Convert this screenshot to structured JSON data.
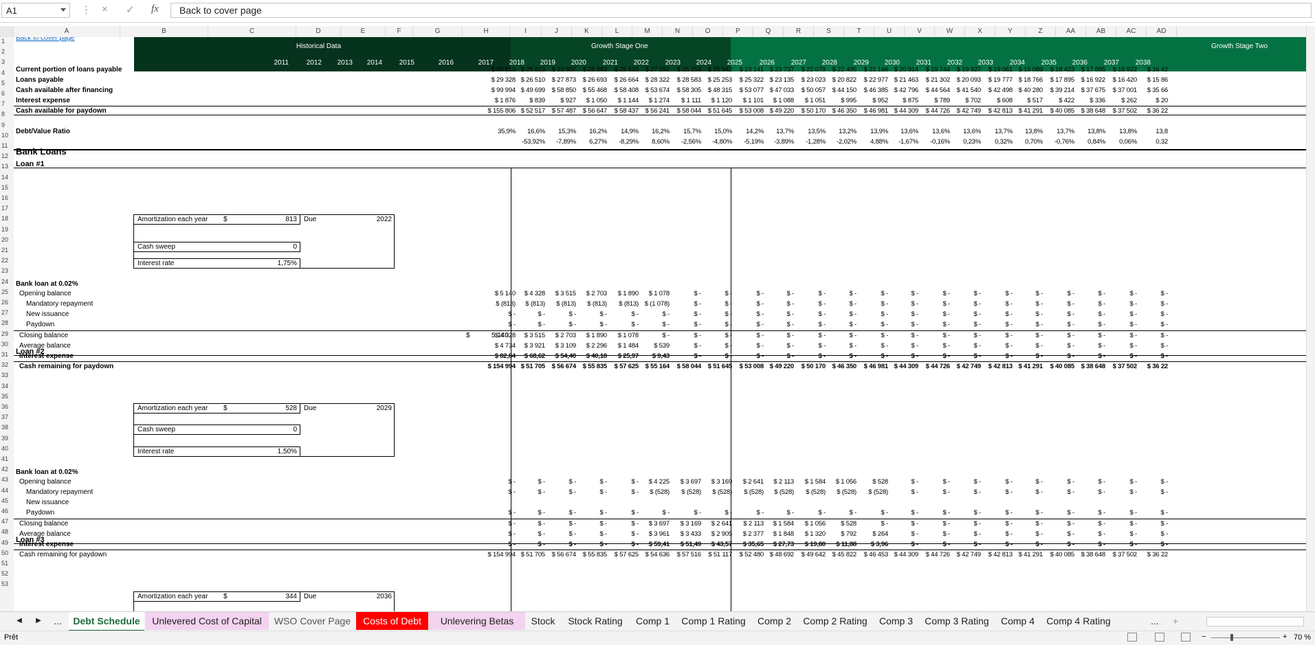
{
  "formula_bar": {
    "cell_ref": "A1",
    "content": "Back to cover page",
    "cancel_icon": "×",
    "enter_icon": "✓",
    "fx_icon": "fx"
  },
  "columns": [
    "A",
    "B",
    "C",
    "D",
    "E",
    "F",
    "G",
    "H",
    "I",
    "J",
    "K",
    "L",
    "M",
    "N",
    "O",
    "P",
    "Q",
    "R",
    "S",
    "T",
    "U",
    "V",
    "W",
    "X",
    "Y",
    "Z",
    "AA",
    "AB",
    "AC",
    "AD"
  ],
  "rows": [
    "1",
    "2",
    "3",
    "4",
    "5",
    "6",
    "7",
    "8",
    "9",
    "10",
    "11",
    "12",
    "13",
    "14",
    "15",
    "16",
    "17",
    "18",
    "19",
    "20",
    "21",
    "22",
    "23",
    "24",
    "25",
    "26",
    "27",
    "28",
    "29",
    "30",
    "31",
    "32",
    "33",
    "34",
    "35",
    "36",
    "37",
    "38",
    "39",
    "40",
    "41",
    "42",
    "43",
    "44",
    "45",
    "46",
    "47",
    "48",
    "49",
    "50",
    "51",
    "52",
    "53"
  ],
  "header": {
    "back_link": "Back to cover page",
    "historical": "Historical Data",
    "stage_one": "Growth Stage One",
    "stage_two": "Growth Stage Two",
    "years": [
      "2011",
      "2012",
      "2013",
      "2014",
      "2015",
      "2016",
      "2017",
      "2018",
      "2019",
      "2020",
      "2021",
      "2022",
      "2023",
      "2024",
      "2025",
      "2026",
      "2027",
      "2028",
      "2029",
      "2030",
      "2031",
      "2032",
      "2033",
      "2034",
      "2035",
      "2036",
      "2037",
      "2038"
    ],
    "band_colors": {
      "historical": "#05331e",
      "stage_one": "#054425",
      "stage_two": "#047143"
    }
  },
  "summary": {
    "labels": {
      "r5": "Current portion of loans payable",
      "r6": "Loans payable",
      "r7": "Cash available after financing",
      "r8": "Interest expense",
      "r10": "Cash available for paydown",
      "r12": "Debt/Value Ratio"
    },
    "r5": [
      "$ 80 813",
      "$ 25 813",
      "$ 23 807",
      "$ 25 983",
      "$ 25 615",
      "$ 27 192",
      "$ 25 153",
      "$ 25 942",
      "$ 23 141",
      "$ 23 737",
      "$ 22 079",
      "$ 22 495",
      "$ 21 166",
      "$ 20 914",
      "$ 19 744",
      "$ 19 927",
      "$ 19 061",
      "$ 19 089",
      "$ 18 423",
      "$ 17 895",
      "$ 16 922",
      "$ 16 42"
    ],
    "r6": [
      "$ 29 328",
      "$ 26 510",
      "$ 27 873",
      "$ 26 693",
      "$ 26 664",
      "$ 28 322",
      "$ 28 583",
      "$ 25 253",
      "$ 25 322",
      "$ 23 135",
      "$ 23 023",
      "$ 20 822",
      "$ 22 977",
      "$ 21 463",
      "$ 21 302",
      "$ 20 093",
      "$ 19 777",
      "$ 18 766",
      "$ 17 895",
      "$ 16 922",
      "$ 16 420",
      "$ 15 86"
    ],
    "r7": [
      "$ 99 994",
      "$ 49 699",
      "$ 58 850",
      "$ 55 468",
      "$ 58 408",
      "$ 53 674",
      "$ 58 305",
      "$ 48 315",
      "$ 53 077",
      "$ 47 033",
      "$ 50 057",
      "$ 44 150",
      "$ 46 385",
      "$ 42 796",
      "$ 44 564",
      "$ 41 540",
      "$ 42 498",
      "$ 40 280",
      "$ 39 214",
      "$ 37 675",
      "$ 37 001",
      "$ 35 66"
    ],
    "r8": [
      "$ 1 876",
      "$ 839",
      "$ 927",
      "$ 1 050",
      "$ 1 144",
      "$ 1 274",
      "$ 1 111",
      "$ 1 120",
      "$ 1 101",
      "$ 1 088",
      "$ 1 051",
      "$ 995",
      "$ 952",
      "$ 875",
      "$ 789",
      "$ 702",
      "$ 608",
      "$ 517",
      "$ 422",
      "$ 336",
      "$ 262",
      "$ 20"
    ],
    "r10": [
      "$ 155 806",
      "$ 52 517",
      "$ 57 487",
      "$ 56 647",
      "$ 58 437",
      "$ 56 241",
      "$ 58 044",
      "$ 51 645",
      "$ 53 008",
      "$ 49 220",
      "$ 50 170",
      "$ 46 350",
      "$ 46 981",
      "$ 44 309",
      "$ 44 726",
      "$ 42 749",
      "$ 42 813",
      "$ 41 291",
      "$ 40 085",
      "$ 38 648",
      "$ 37 502",
      "$ 36 22"
    ],
    "r12": [
      "35,9%",
      "16,6%",
      "15,3%",
      "16,2%",
      "14,9%",
      "16,2%",
      "15,7%",
      "15,0%",
      "14,2%",
      "13,7%",
      "13,5%",
      "13,2%",
      "13,9%",
      "13,6%",
      "13,6%",
      "13,6%",
      "13,7%",
      "13,8%",
      "13,7%",
      "13,8%",
      "13,8%",
      "13,8"
    ],
    "r13": [
      "",
      "-53,92%",
      "-7,89%",
      "6,27%",
      "-8,29%",
      "8,60%",
      "-2,56%",
      "-4,80%",
      "-5,19%",
      "-3,89%",
      "-1,28%",
      "-2,02%",
      "4,88%",
      "-1,67%",
      "-0,16%",
      "0,23%",
      "0,32%",
      "0,70%",
      "-0,76%",
      "0,84%",
      "0,06%",
      "0,32"
    ]
  },
  "bank_loans_title": "Bank Loans",
  "loan1": {
    "title": "Loan #1",
    "amort_label": "Amortization each year",
    "amort_cur": "$",
    "amort_value": "813",
    "due_label": "Due",
    "due_value": "2022",
    "sweep_label": "Cash sweep",
    "sweep_value": "0",
    "rate_label": "Interest rate",
    "rate_value": "1,75%",
    "section_label": "Bank loan at 0.02%",
    "row_labels": [
      "Opening balance",
      "Mandatory repayment",
      "New issuance",
      "Paydown",
      "Closing balance",
      "Average balance",
      "Interest expense",
      "Cash remaining for paydown"
    ],
    "h27_cur": "$",
    "h27_value": "5 140",
    "r23": [
      "$ 5 140",
      "$ 4 328",
      "$ 3 515",
      "$ 2 703",
      "$ 1 890",
      "$ 1 078",
      "$ -",
      "$ -",
      "$ -",
      "$ -",
      "$ -",
      "$ -",
      "$ -",
      "$ -",
      "$ -",
      "$ -",
      "$ -",
      "$ -",
      "$ -",
      "$ -",
      "$ -",
      "$ -"
    ],
    "r24": [
      "$ (813)",
      "$ (813)",
      "$ (813)",
      "$ (813)",
      "$ (813)",
      "$ (1 078)",
      "$ -",
      "$ -",
      "$ -",
      "$ -",
      "$ -",
      "$ -",
      "$ -",
      "$ -",
      "$ -",
      "$ -",
      "$ -",
      "$ -",
      "$ -",
      "$ -",
      "$ -",
      "$ -"
    ],
    "r25": [
      "$ -",
      "$ -",
      "$ -",
      "$ -",
      "$ -",
      "$ -",
      "$ -",
      "$ -",
      "$ -",
      "$ -",
      "$ -",
      "$ -",
      "$ -",
      "$ -",
      "$ -",
      "$ -",
      "$ -",
      "$ -",
      "$ -",
      "$ -",
      "$ -",
      "$ -"
    ],
    "r26": [
      "$ -",
      "$ -",
      "$ -",
      "$ -",
      "$ -",
      "$ -",
      "$ -",
      "$ -",
      "$ -",
      "$ -",
      "$ -",
      "$ -",
      "$ -",
      "$ -",
      "$ -",
      "$ -",
      "$ -",
      "$ -",
      "$ -",
      "$ -",
      "$ -",
      "$ -"
    ],
    "r27": [
      "$ 4 328",
      "$ 3 515",
      "$ 2 703",
      "$ 1 890",
      "$ 1 078",
      "$ -",
      "$ -",
      "$ -",
      "$ -",
      "$ -",
      "$ -",
      "$ -",
      "$ -",
      "$ -",
      "$ -",
      "$ -",
      "$ -",
      "$ -",
      "$ -",
      "$ -",
      "$ -",
      "$ -"
    ],
    "r28": [
      "$ 4 734",
      "$ 3 921",
      "$ 3 109",
      "$ 2 296",
      "$ 1 484",
      "$ 539",
      "$ -",
      "$ -",
      "$ -",
      "$ -",
      "$ -",
      "$ -",
      "$ -",
      "$ -",
      "$ -",
      "$ -",
      "$ -",
      "$ -",
      "$ -",
      "$ -",
      "$ -",
      "$ -"
    ],
    "r29": [
      "$ 82,84",
      "$ 68,62",
      "$ 54,40",
      "$ 40,18",
      "$ 25,97",
      "$ 9,43",
      "$ -",
      "$ -",
      "$ -",
      "$ -",
      "$ -",
      "$ -",
      "$ -",
      "$ -",
      "$ -",
      "$ -",
      "$ -",
      "$ -",
      "$ -",
      "$ -",
      "$ -",
      "$ -"
    ],
    "r30": [
      "$ 154 994",
      "$ 51 705",
      "$ 56 674",
      "$ 55 835",
      "$ 57 625",
      "$ 55 164",
      "$ 58 044",
      "$ 51 645",
      "$ 53 008",
      "$ 49 220",
      "$ 50 170",
      "$ 46 350",
      "$ 46 981",
      "$ 44 309",
      "$ 44 726",
      "$ 42 749",
      "$ 42 813",
      "$ 41 291",
      "$ 40 085",
      "$ 38 648",
      "$ 37 502",
      "$ 36 22"
    ]
  },
  "loan2": {
    "title": "Loan #2",
    "amort_label": "Amortization each year",
    "amort_cur": "$",
    "amort_value": "528",
    "due_label": "Due",
    "due_value": "2029",
    "sweep_label": "Cash sweep",
    "sweep_value": "0",
    "rate_label": "Interest rate",
    "rate_value": "1,50%",
    "section_label": "Bank loan at 0.02%",
    "row_labels": [
      "Opening balance",
      "Mandatory repayment",
      "New issuance",
      "Paydown",
      "Closing balance",
      "Average balance",
      "Interest expense",
      "Cash remaining for paydown"
    ],
    "r41": [
      "$ -",
      "$ -",
      "$ -",
      "$ -",
      "$ -",
      "$ 4 225",
      "$ 3 697",
      "$ 3 169",
      "$ 2 641",
      "$ 2 113",
      "$ 1 584",
      "$ 1 056",
      "$ 528",
      "$ -",
      "$ -",
      "$ -",
      "$ -",
      "$ -",
      "$ -",
      "$ -",
      "$ -",
      "$ -"
    ],
    "r42": [
      "$ -",
      "$ -",
      "$ -",
      "$ -",
      "$ -",
      "$ (528)",
      "$ (528)",
      "$ (528)",
      "$ (528)",
      "$ (528)",
      "$ (528)",
      "$ (528)",
      "$ (528)",
      "$ -",
      "$ -",
      "$ -",
      "$ -",
      "$ -",
      "$ -",
      "$ -",
      "$ -",
      "$ -"
    ],
    "r44": [
      "$ -",
      "$ -",
      "$ -",
      "$ -",
      "$ -",
      "$ -",
      "$ -",
      "$ -",
      "$ -",
      "$ -",
      "$ -",
      "$ -",
      "$ -",
      "$ -",
      "$ -",
      "$ -",
      "$ -",
      "$ -",
      "$ -",
      "$ -",
      "$ -",
      "$ -"
    ],
    "r45": [
      "$ -",
      "$ -",
      "$ -",
      "$ -",
      "$ -",
      "$ 3 697",
      "$ 3 169",
      "$ 2 641",
      "$ 2 113",
      "$ 1 584",
      "$ 1 056",
      "$ 528",
      "$ -",
      "$ -",
      "$ -",
      "$ -",
      "$ -",
      "$ -",
      "$ -",
      "$ -",
      "$ -",
      "$ -"
    ],
    "r46": [
      "$ -",
      "$ -",
      "$ -",
      "$ -",
      "$ -",
      "$ 3 961",
      "$ 3 433",
      "$ 2 905",
      "$ 2 377",
      "$ 1 848",
      "$ 1 320",
      "$ 792",
      "$ 264",
      "$ -",
      "$ -",
      "$ -",
      "$ -",
      "$ -",
      "$ -",
      "$ -",
      "$ -",
      "$ -"
    ],
    "r47": [
      "$ -",
      "$ -",
      "$ -",
      "$ -",
      "$ -",
      "$ 59,41",
      "$ 51,49",
      "$ 43,57",
      "$ 35,65",
      "$ 27,73",
      "$ 19,80",
      "$ 11,88",
      "$ 3,96",
      "$ -",
      "$ -",
      "$ -",
      "$ -",
      "$ -",
      "$ -",
      "$ -",
      "$ -",
      "$ -"
    ],
    "r48": [
      "$ 154 994",
      "$ 51 705",
      "$ 56 674",
      "$ 55 835",
      "$ 57 625",
      "$ 54 636",
      "$ 57 516",
      "$ 51 117",
      "$ 52 480",
      "$ 48 692",
      "$ 49 642",
      "$ 45 822",
      "$ 46 453",
      "$ 44 309",
      "$ 44 726",
      "$ 42 749",
      "$ 42 813",
      "$ 41 291",
      "$ 40 085",
      "$ 38 648",
      "$ 37 502",
      "$ 36 22"
    ]
  },
  "loan3": {
    "title": "Loan #3",
    "amort_label": "Amortization each year",
    "amort_cur": "$",
    "amort_value": "344",
    "due_label": "Due",
    "due_value": "2036"
  },
  "tabs": [
    {
      "label": "Debt Schedule",
      "bg": "#ffffff",
      "fg": "#1e6b3a",
      "active": true
    },
    {
      "label": "Unlevered Cost of Capital",
      "bg": "#f3d3f0",
      "fg": "#222222",
      "active": false
    },
    {
      "label": "WSO Cover Page",
      "bg": "#f3f3f3",
      "fg": "#555555",
      "active": false
    },
    {
      "label": "Costs of Debt",
      "bg": "#ff0000",
      "fg": "#ffffff",
      "active": false
    },
    {
      "label": "Unlevering Betas",
      "bg": "#f3d3f0",
      "fg": "#222222",
      "active": false
    },
    {
      "label": "Stock",
      "bg": "#f3f3f3",
      "fg": "#222222",
      "active": false
    },
    {
      "label": "Stock Rating",
      "bg": "#f3f3f3",
      "fg": "#222222",
      "active": false
    },
    {
      "label": "Comp 1",
      "bg": "#f3f3f3",
      "fg": "#222222",
      "active": false
    },
    {
      "label": "Comp 1 Rating",
      "bg": "#f3f3f3",
      "fg": "#222222",
      "active": false
    },
    {
      "label": "Comp 2",
      "bg": "#f3f3f3",
      "fg": "#222222",
      "active": false
    },
    {
      "label": "Comp 2 Rating",
      "bg": "#f3f3f3",
      "fg": "#222222",
      "active": false
    },
    {
      "label": "Comp 3",
      "bg": "#f3f3f3",
      "fg": "#222222",
      "active": false
    },
    {
      "label": "Comp 3 Rating",
      "bg": "#f3f3f3",
      "fg": "#222222",
      "active": false
    },
    {
      "label": "Comp 4",
      "bg": "#f3f3f3",
      "fg": "#222222",
      "active": false
    },
    {
      "label": "Comp 4 Rating",
      "bg": "#f3f3f3",
      "fg": "#222222",
      "active": false
    }
  ],
  "tab_nav": {
    "prev": "◀",
    "next": "▶",
    "more_left": "...",
    "more_right": "...",
    "add": "+"
  },
  "status": {
    "ready": "Prêt",
    "zoom": "70 %",
    "zoom_minus": "−",
    "zoom_plus": "+"
  }
}
